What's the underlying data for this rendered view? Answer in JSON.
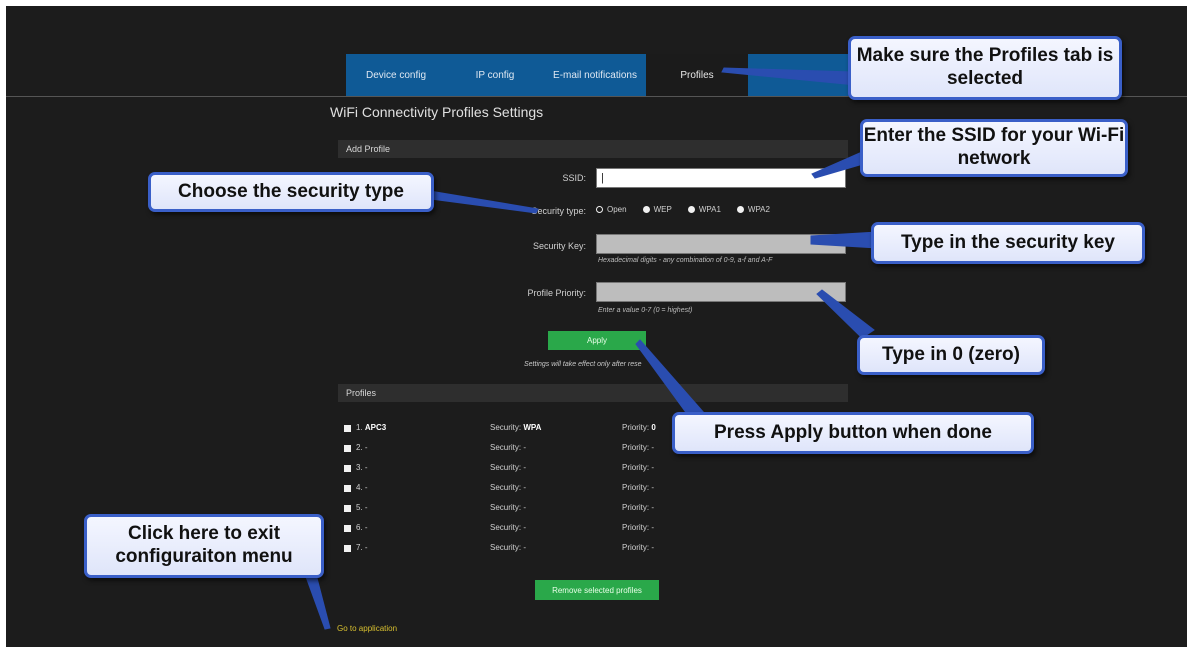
{
  "tabs": [
    "Device config",
    "IP config",
    "E-mail notifications",
    "Profiles"
  ],
  "page_title": "WiFi Connectivity Profiles Settings",
  "add_profile": {
    "header": "Add Profile",
    "ssid_label": "SSID:",
    "ssid_value": "|",
    "security_type_label": "Security type:",
    "security_options": [
      "Open",
      "WEP",
      "WPA1",
      "WPA2"
    ],
    "selected_security": "Open",
    "security_key_label": "Security Key:",
    "security_key_hint": "Hexadecimal digits - any combination of 0-9, a-f and A-F",
    "priority_label": "Profile Priority:",
    "priority_hint": "Enter a value 0-7 (0 = highest)",
    "apply_label": "Apply",
    "apply_note": "Settings will take effect only after rese"
  },
  "profiles": {
    "header": "Profiles",
    "security_prefix": "Security:",
    "priority_prefix": "Priority:",
    "rows": [
      {
        "index": "1.",
        "name": "APC3",
        "security": "WPA",
        "priority": "0"
      },
      {
        "index": "2.",
        "name": "-",
        "security": "-",
        "priority": "-"
      },
      {
        "index": "3.",
        "name": "-",
        "security": "-",
        "priority": "-"
      },
      {
        "index": "4.",
        "name": "-",
        "security": "-",
        "priority": "-"
      },
      {
        "index": "5.",
        "name": "-",
        "security": "-",
        "priority": "-"
      },
      {
        "index": "6.",
        "name": "-",
        "security": "-",
        "priority": "-"
      },
      {
        "index": "7.",
        "name": "-",
        "security": "-",
        "priority": "-"
      }
    ],
    "remove_label": "Remove selected profiles"
  },
  "go_to_application": "Go to application",
  "callouts": {
    "profiles_tab": "Make sure the Profiles tab is selected",
    "ssid": "Enter the SSID for your Wi-Fi network",
    "security_type": "Choose the security type",
    "security_key": "Type in the security key",
    "priority": "Type in 0 (zero)",
    "apply": "Press Apply button when done",
    "exit": "Click here to exit configuraiton menu"
  },
  "colors": {
    "tab_blue": "#0f5a96",
    "apply_green": "#2aa84a",
    "callout_border": "#3a5fc8",
    "link_yellow": "#d8c030"
  }
}
